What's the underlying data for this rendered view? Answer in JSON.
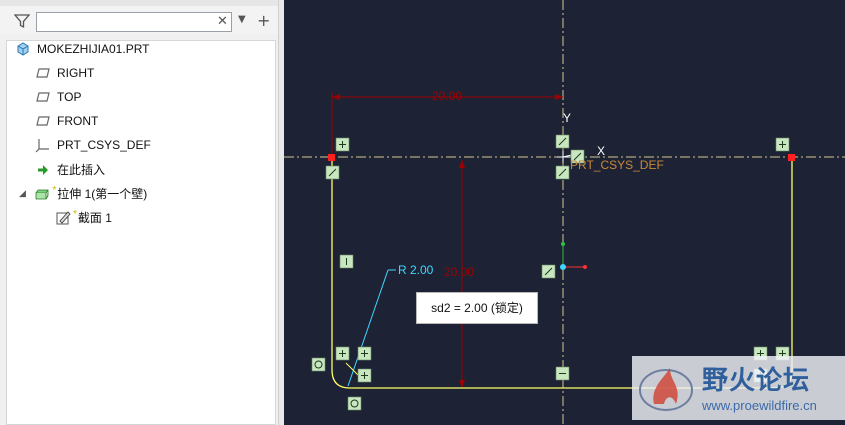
{
  "model_tree": {
    "search": {
      "value": "",
      "placeholder": ""
    },
    "items": [
      {
        "label": "MOKEZHIJIA01.PRT",
        "icon": "part-icon"
      },
      {
        "label": "RIGHT",
        "icon": "datum-plane-icon"
      },
      {
        "label": "TOP",
        "icon": "datum-plane-icon"
      },
      {
        "label": "FRONT",
        "icon": "datum-plane-icon"
      },
      {
        "label": "PRT_CSYS_DEF",
        "icon": "coordinate-system-icon"
      },
      {
        "label": "在此插入",
        "icon": "insert-here-arrow-icon"
      },
      {
        "label": "拉伸 1(第一个壁)",
        "icon": "extrude-feature-icon",
        "star": "*"
      },
      {
        "label": "截面 1",
        "icon": "sketch-section-icon",
        "star": "*"
      }
    ]
  },
  "sketch": {
    "dim_horizontal": "20.00",
    "dim_vertical": "20.00",
    "dim_radius": "R 2.00",
    "axis_y": "Y",
    "axis_x": "X",
    "csys_label": "PRT_CSYS_DEF",
    "tooltip": "sd2 = 2.00 (锁定)"
  },
  "watermark": {
    "title": "野火论坛",
    "url": "www.proewildfire.cn"
  },
  "colors": {
    "canvas_bg": "#1d2235",
    "sketch_geometry": "#ffff66",
    "dimension_dark_red": "#a00000",
    "radius_dimension": "#40d8ff",
    "centerline": "#d8c890",
    "constraint_box_bg": "#c8e6c0"
  }
}
